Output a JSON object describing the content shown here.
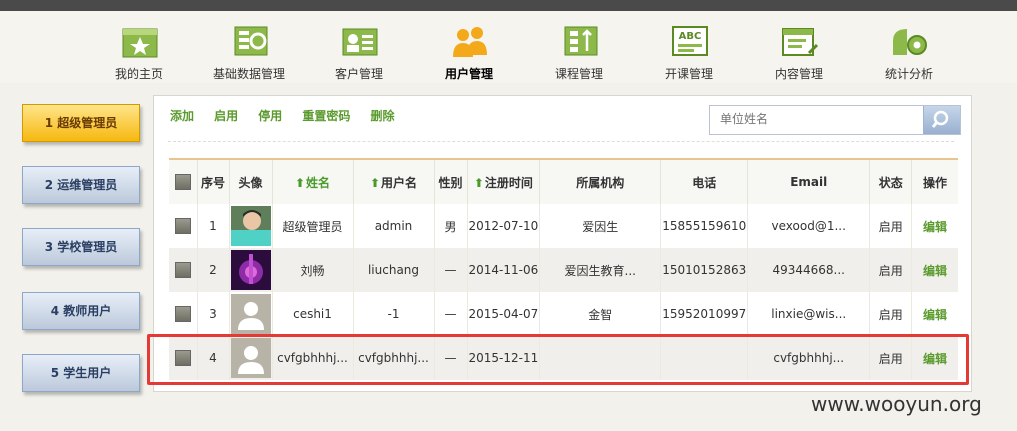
{
  "nav": {
    "items": [
      {
        "label": "我的主页",
        "icon": "home-star-icon"
      },
      {
        "label": "基础数据管理",
        "icon": "data-sync-icon"
      },
      {
        "label": "客户管理",
        "icon": "customer-card-icon"
      },
      {
        "label": "用户管理",
        "icon": "users-icon",
        "active": true
      },
      {
        "label": "课程管理",
        "icon": "course-tree-icon"
      },
      {
        "label": "开课管理",
        "icon": "abc-board-icon"
      },
      {
        "label": "内容管理",
        "icon": "content-edit-icon"
      },
      {
        "label": "统计分析",
        "icon": "chart-gear-icon"
      }
    ]
  },
  "sidebar": {
    "items": [
      {
        "label": "1 超级管理员",
        "active": true
      },
      {
        "label": "2 运维管理员"
      },
      {
        "label": "3 学校管理员"
      },
      {
        "label": "4 教师用户"
      },
      {
        "label": "5 学生用户"
      }
    ]
  },
  "toolbar": {
    "add": "添加",
    "enable": "启用",
    "disable": "停用",
    "reset_password": "重置密码",
    "delete": "删除"
  },
  "search": {
    "placeholder": "单位姓名"
  },
  "table": {
    "headers": {
      "index": "序号",
      "avatar": "头像",
      "name": "姓名",
      "username": "用户名",
      "gender": "性别",
      "register_time": "注册时间",
      "org": "所属机构",
      "phone": "电话",
      "email": "Email",
      "status": "状态",
      "action": "操作"
    },
    "rows": [
      {
        "index": "1",
        "avatar": "photo-person",
        "name": "超级管理员",
        "username": "admin",
        "gender": "男",
        "register_time": "2012-07-10",
        "org": "爱因生",
        "phone": "15855159610",
        "email": "vexood@1...",
        "status": "启用",
        "action": "编辑"
      },
      {
        "index": "2",
        "avatar": "photo-purple",
        "name": "刘畅",
        "username": "liuchang",
        "gender": "—",
        "register_time": "2014-11-06",
        "org": "爱因生教育...",
        "phone": "15010152863",
        "email": "49344668...",
        "status": "启用",
        "action": "编辑"
      },
      {
        "index": "3",
        "avatar": "default-user",
        "name": "ceshi1",
        "username": "-1",
        "gender": "—",
        "register_time": "2015-04-07",
        "org": "金智",
        "phone": "15952010997",
        "email": "linxie@wis...",
        "status": "启用",
        "action": "编辑"
      },
      {
        "index": "4",
        "avatar": "default-user",
        "name": "cvfgbhhhj...",
        "username": "cvfgbhhhj...",
        "gender": "—",
        "register_time": "2015-12-11",
        "org": "",
        "phone": "",
        "email": "cvfgbhhhj...",
        "status": "启用",
        "action": "编辑"
      }
    ]
  },
  "colors": {
    "accent_green": "#5b9b2e",
    "highlight_red": "#e53935",
    "active_tab": "#f6b810"
  },
  "watermark": "www.wooyun.org"
}
